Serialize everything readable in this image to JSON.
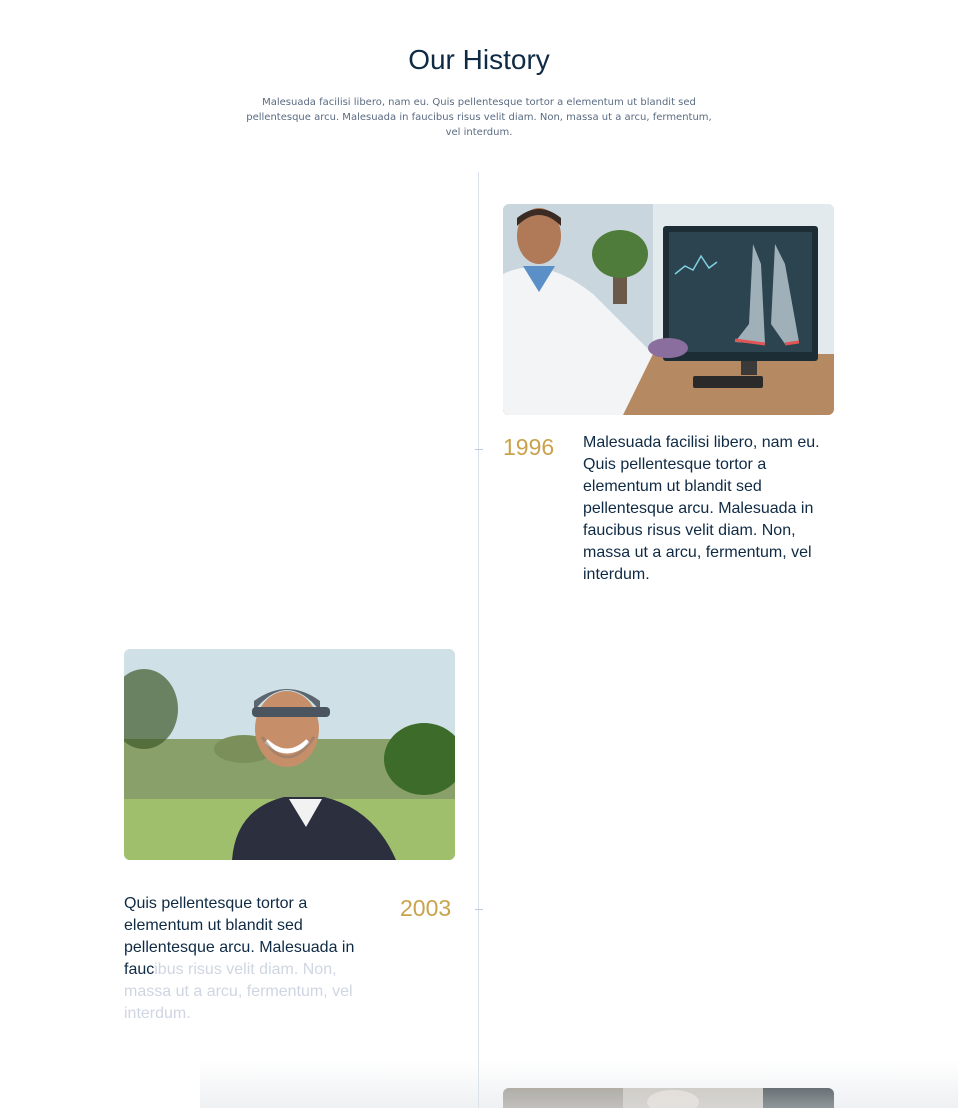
{
  "section": {
    "title": "Our History",
    "intro": "Malesuada facilisi libero, nam eu. Quis pellentesque tortor a elementum ut blandit sed pellentesque arcu. Malesuada in faucibus risus velit diam. Non, massa ut a arcu, fermentum, vel interdum."
  },
  "timeline": {
    "entries": [
      {
        "year": "1996",
        "text": "Malesuada facilisi libero, nam eu. Quis pellentesque tortor a elementum ut blandit sed pellentesque arcu. Malesuada in faucibus risus velit diam. Non, massa ut a arcu, fermentum, vel interdum.",
        "image": "doctor-viewing-foot-xray-photo"
      },
      {
        "year": "2003",
        "text_visible": "Quis pellentesque tortor a elementum ut blandit sed pellentesque arcu. Malesuada in fauc",
        "text_faded": "ibus risus velit diam. Non, massa ut a arcu, fermentum, vel interdum.",
        "image": "smiling-golfer-photo"
      },
      {
        "image": "partial-third-photo"
      }
    ]
  },
  "colors": {
    "heading": "#0f2a44",
    "year_accent": "#c9a24c",
    "timeline_line": "#d9e2ec"
  }
}
